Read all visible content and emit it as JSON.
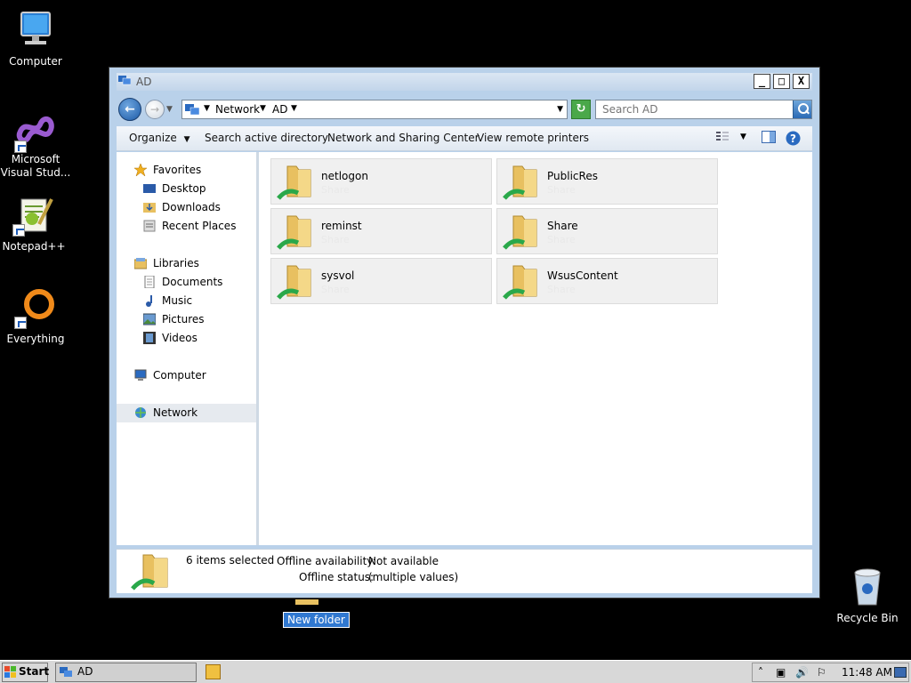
{
  "desktop": {
    "icons": [
      {
        "label": "Computer"
      },
      {
        "label": "Microsoft Visual Stud..."
      },
      {
        "label": "Notepad++"
      },
      {
        "label": "Everything"
      },
      {
        "label": "Recycle Bin"
      }
    ],
    "rename_text": "New folder"
  },
  "window": {
    "title": "AD",
    "controls": {
      "minimize": "_",
      "maximize": "□",
      "close": "X"
    },
    "address": {
      "crumbs": [
        "Network",
        "AD"
      ]
    },
    "search": {
      "placeholder": "Search AD"
    },
    "toolbar": {
      "organize": "Organize",
      "search_ad": "Search active directory",
      "network_sharing": "Network and Sharing Center",
      "remote_printers": "View remote printers"
    },
    "nav": {
      "favorites": "Favorites",
      "desktop": "Desktop",
      "downloads": "Downloads",
      "recent": "Recent Places",
      "libraries": "Libraries",
      "documents": "Documents",
      "music": "Music",
      "pictures": "Pictures",
      "videos": "Videos",
      "computer": "Computer",
      "network": "Network"
    },
    "items": [
      {
        "name": "netlogon",
        "sub": "Share"
      },
      {
        "name": "PublicRes",
        "sub": "Share"
      },
      {
        "name": "reminst",
        "sub": "Share"
      },
      {
        "name": "Share",
        "sub": "Share"
      },
      {
        "name": "sysvol",
        "sub": "Share"
      },
      {
        "name": "WsusContent",
        "sub": "Share"
      }
    ],
    "details": {
      "selected": "6 items selected",
      "offline_availability_label": "Offline availability:",
      "offline_availability_value": "Not available",
      "offline_status_label": "Offline status:",
      "offline_status_value": "(multiple values)"
    }
  },
  "taskbar": {
    "start": "Start",
    "task": "AD",
    "clock": "11:48 AM"
  }
}
